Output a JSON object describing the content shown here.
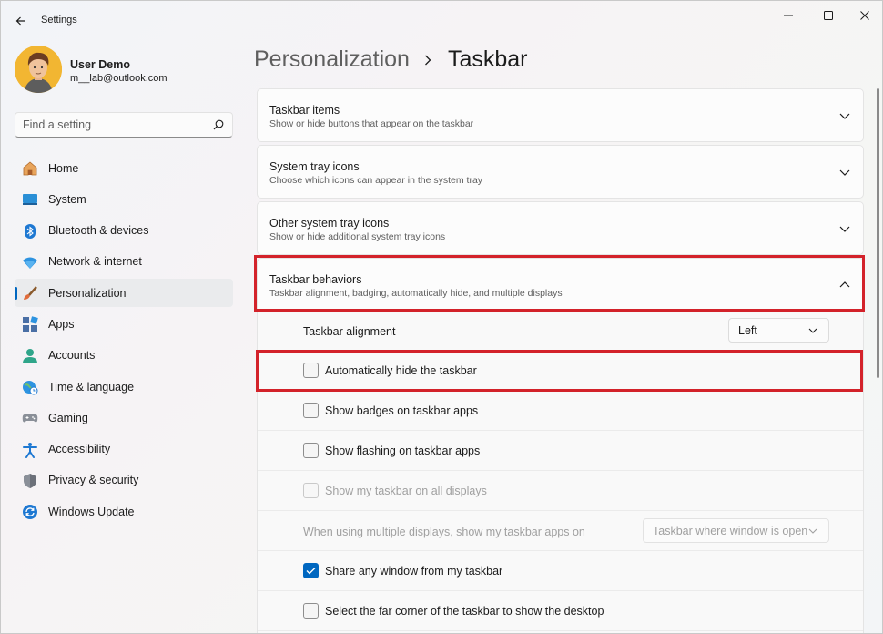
{
  "window": {
    "title": "Settings",
    "controls": {
      "minimize": "minimize",
      "maximize": "maximize",
      "close": "close"
    }
  },
  "profile": {
    "name": "User Demo",
    "email": "m__lab@outlook.com"
  },
  "search": {
    "placeholder": "Find a setting",
    "value": ""
  },
  "nav": [
    {
      "label": "Home",
      "icon": "home-icon"
    },
    {
      "label": "System",
      "icon": "display-icon"
    },
    {
      "label": "Bluetooth & devices",
      "icon": "bluetooth-icon"
    },
    {
      "label": "Network & internet",
      "icon": "wifi-icon"
    },
    {
      "label": "Personalization",
      "icon": "brush-icon",
      "active": true
    },
    {
      "label": "Apps",
      "icon": "apps-icon"
    },
    {
      "label": "Accounts",
      "icon": "person-icon"
    },
    {
      "label": "Time & language",
      "icon": "globe-clock-icon"
    },
    {
      "label": "Gaming",
      "icon": "gamepad-icon"
    },
    {
      "label": "Accessibility",
      "icon": "accessibility-icon"
    },
    {
      "label": "Privacy & security",
      "icon": "shield-icon"
    },
    {
      "label": "Windows Update",
      "icon": "update-icon"
    }
  ],
  "breadcrumb": {
    "parent": "Personalization",
    "current": "Taskbar"
  },
  "sections": [
    {
      "title": "Taskbar items",
      "desc": "Show or hide buttons that appear on the taskbar",
      "expanded": false
    },
    {
      "title": "System tray icons",
      "desc": "Choose which icons can appear in the system tray",
      "expanded": false
    },
    {
      "title": "Other system tray icons",
      "desc": "Show or hide additional system tray icons",
      "expanded": false
    },
    {
      "title": "Taskbar behaviors",
      "desc": "Taskbar alignment, badging, automatically hide, and multiple displays",
      "expanded": true
    }
  ],
  "behaviors": {
    "alignment_label": "Taskbar alignment",
    "alignment_value": "Left",
    "checkboxes": [
      {
        "label": "Automatically hide the taskbar",
        "checked": false,
        "disabled": false
      },
      {
        "label": "Show badges on taskbar apps",
        "checked": false,
        "disabled": false
      },
      {
        "label": "Show flashing on taskbar apps",
        "checked": false,
        "disabled": false
      },
      {
        "label": "Show my taskbar on all displays",
        "checked": false,
        "disabled": true
      }
    ],
    "multi_display_label": "When using multiple displays, show my taskbar apps on",
    "multi_display_value": "Taskbar where window is open",
    "share_label": "Share any window from my taskbar",
    "share_checked": true,
    "far_corner_label": "Select the far corner of the taskbar to show the desktop",
    "far_corner_checked": false
  },
  "colors": {
    "accent": "#0067c0",
    "highlight": "#d3222a"
  }
}
